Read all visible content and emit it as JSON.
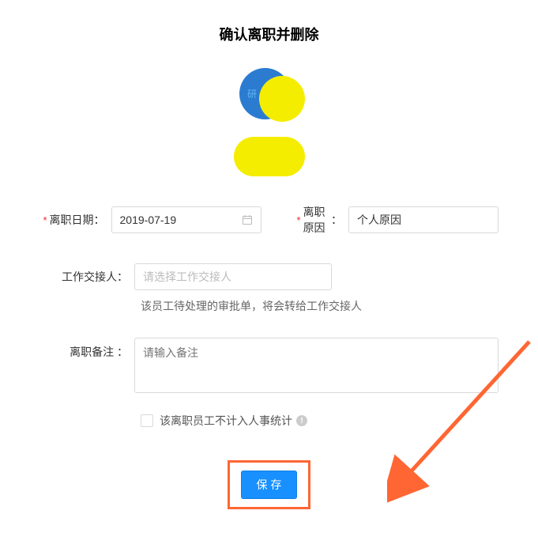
{
  "title": "确认离职并删除",
  "avatar": {
    "initial": "研"
  },
  "form": {
    "resign_date": {
      "label": "离职日期",
      "value": "2019-07-19"
    },
    "resign_reason": {
      "label": "离职原因",
      "value": "个人原因"
    },
    "handover": {
      "label": "工作交接人",
      "placeholder": "请选择工作交接人",
      "help": "该员工待处理的审批单，将会转给工作交接人"
    },
    "remark": {
      "label": "离职备注",
      "placeholder": "请输入备注"
    },
    "checkbox": {
      "label": "该离职员工不计入人事统计"
    },
    "colon": "："
  },
  "buttons": {
    "save": "保 存"
  }
}
